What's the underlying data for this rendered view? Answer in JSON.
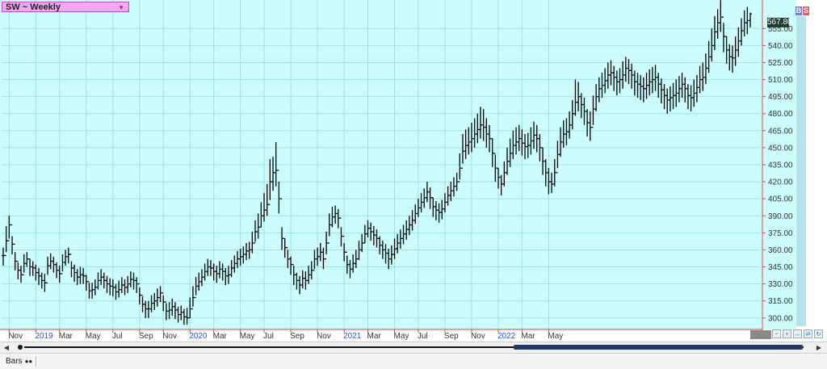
{
  "window": {
    "symbol_label": "SW ~ Weekly",
    "last_price": "567.80",
    "buy_label": "B",
    "sell_label": "S",
    "tab_label": "Bars"
  },
  "colors": {
    "plot_bg": "#ccfcfc",
    "grid": "#9ee0ea",
    "bar": "#000000",
    "axis_line": "#d44",
    "axis_text": "#333",
    "year_text": "#2a4fd0"
  },
  "chart_data": {
    "type": "ohlc",
    "title": "",
    "xlabel": "",
    "ylabel": "",
    "ylim": [
      290,
      580
    ],
    "y_ticks": [
      300,
      315,
      330,
      345,
      360,
      375,
      390,
      405,
      420,
      435,
      450,
      465,
      480,
      495,
      510,
      525,
      540,
      555
    ],
    "y_tick_labels": [
      "300.00",
      "315.00",
      "330.00",
      "345.00",
      "360.00",
      "375.00",
      "390.00",
      "405.00",
      "420.00",
      "435.00",
      "450.00",
      "465.00",
      "480.00",
      "495.00",
      "510.00",
      "525.00",
      "540.00",
      "555.00"
    ],
    "x_labels": [
      {
        "text": "Nov",
        "week": 2,
        "year": false
      },
      {
        "text": "2019",
        "week": 11,
        "year": true
      },
      {
        "text": "Mar",
        "week": 19,
        "year": false
      },
      {
        "text": "May",
        "week": 28,
        "year": false
      },
      {
        "text": "Jul",
        "week": 37,
        "year": false
      },
      {
        "text": "Sep",
        "week": 46,
        "year": false
      },
      {
        "text": "Nov",
        "week": 54,
        "year": false
      },
      {
        "text": "2020",
        "week": 63,
        "year": true
      },
      {
        "text": "Mar",
        "week": 71,
        "year": false
      },
      {
        "text": "May",
        "week": 80,
        "year": false
      },
      {
        "text": "Jul",
        "week": 88,
        "year": false
      },
      {
        "text": "Sep",
        "week": 97,
        "year": false
      },
      {
        "text": "Nov",
        "week": 106,
        "year": false
      },
      {
        "text": "2021",
        "week": 115,
        "year": true
      },
      {
        "text": "Mar",
        "week": 123,
        "year": false
      },
      {
        "text": "May",
        "week": 132,
        "year": false
      },
      {
        "text": "Jul",
        "week": 140,
        "year": false
      },
      {
        "text": "Sep",
        "week": 149,
        "year": false
      },
      {
        "text": "Nov",
        "week": 158,
        "year": false
      },
      {
        "text": "2022",
        "week": 167,
        "year": true
      },
      {
        "text": "Mar",
        "week": 175,
        "year": false
      },
      {
        "text": "May",
        "week": 184,
        "year": false
      }
    ],
    "closes": [
      355,
      368,
      382,
      365,
      350,
      342,
      338,
      348,
      352,
      345,
      344,
      340,
      337,
      333,
      331,
      346,
      350,
      347,
      342,
      339,
      349,
      354,
      356,
      344,
      340,
      336,
      338,
      337,
      332,
      324,
      325,
      327,
      333,
      336,
      333,
      330,
      328,
      327,
      323,
      325,
      329,
      327,
      330,
      334,
      333,
      330,
      320,
      312,
      308,
      308,
      313,
      315,
      318,
      322,
      314,
      306,
      307,
      310,
      307,
      303,
      305,
      301,
      300,
      308,
      318,
      328,
      332,
      336,
      341,
      345,
      344,
      341,
      339,
      343,
      341,
      337,
      338,
      344,
      348,
      352,
      354,
      356,
      359,
      360,
      366,
      376,
      380,
      390,
      395,
      400,
      420,
      428,
      430,
      405,
      370,
      362,
      352,
      347,
      338,
      333,
      329,
      335,
      333,
      338,
      342,
      352,
      354,
      358,
      352,
      366,
      382,
      389,
      392,
      388,
      372,
      358,
      347,
      343,
      348,
      352,
      360,
      366,
      374,
      379,
      376,
      373,
      370,
      364,
      360,
      357,
      352,
      356,
      361,
      366,
      370,
      374,
      378,
      382,
      386,
      392,
      397,
      402,
      406,
      411,
      406,
      398,
      395,
      393,
      396,
      402,
      408,
      412,
      416,
      420,
      432,
      447,
      452,
      455,
      458,
      462,
      466,
      470,
      468,
      462,
      458,
      445,
      432,
      424,
      418,
      428,
      438,
      445,
      452,
      455,
      458,
      454,
      451,
      452,
      456,
      461,
      458,
      450,
      438,
      428,
      420,
      418,
      428,
      444,
      455,
      462,
      464,
      470,
      480,
      490,
      495,
      488,
      482,
      472,
      468,
      484,
      495,
      502,
      505,
      509,
      514,
      516,
      512,
      508,
      510,
      514,
      520,
      518,
      514,
      508,
      506,
      504,
      502,
      505,
      508,
      510,
      512,
      506,
      501,
      496,
      492,
      494,
      496,
      498,
      502,
      506,
      502,
      496,
      494,
      498,
      503,
      510,
      512,
      520,
      530,
      540,
      552,
      560,
      565,
      548,
      536,
      530,
      529,
      536,
      544,
      553,
      560,
      562,
      567.8
    ],
    "highs": [
      362,
      381,
      390,
      372,
      358,
      349,
      346,
      356,
      358,
      352,
      350,
      347,
      344,
      340,
      339,
      354,
      357,
      354,
      349,
      346,
      356,
      360,
      362,
      350,
      347,
      343,
      345,
      344,
      338,
      331,
      331,
      334,
      340,
      343,
      340,
      337,
      335,
      334,
      330,
      333,
      336,
      334,
      337,
      341,
      340,
      336,
      327,
      319,
      315,
      315,
      320,
      322,
      326,
      328,
      320,
      313,
      314,
      317,
      314,
      310,
      311,
      308,
      309,
      318,
      328,
      336,
      340,
      343,
      348,
      352,
      351,
      348,
      346,
      350,
      348,
      344,
      346,
      351,
      355,
      359,
      361,
      363,
      366,
      367,
      376,
      386,
      392,
      402,
      410,
      418,
      440,
      442,
      455,
      420,
      380,
      370,
      360,
      354,
      346,
      340,
      337,
      342,
      341,
      346,
      350,
      360,
      362,
      366,
      362,
      376,
      392,
      398,
      399,
      396,
      380,
      366,
      355,
      351,
      356,
      360,
      368,
      374,
      382,
      386,
      384,
      381,
      378,
      372,
      368,
      365,
      361,
      364,
      370,
      374,
      378,
      382,
      386,
      390,
      395,
      400,
      405,
      410,
      414,
      420,
      415,
      406,
      403,
      401,
      404,
      410,
      416,
      420,
      424,
      428,
      445,
      462,
      466,
      468,
      472,
      476,
      480,
      486,
      484,
      476,
      470,
      458,
      444,
      432,
      426,
      438,
      450,
      458,
      465,
      468,
      470,
      466,
      462,
      463,
      468,
      473,
      470,
      462,
      450,
      440,
      432,
      428,
      440,
      456,
      468,
      474,
      476,
      482,
      492,
      510,
      508,
      498,
      494,
      484,
      482,
      496,
      506,
      512,
      516,
      520,
      525,
      527,
      522,
      518,
      520,
      526,
      530,
      528,
      524,
      518,
      516,
      514,
      512,
      516,
      519,
      521,
      523,
      516,
      511,
      506,
      502,
      504,
      507,
      510,
      513,
      516,
      512,
      506,
      505,
      510,
      514,
      522,
      525,
      533,
      544,
      555,
      566,
      572,
      580,
      560,
      548,
      541,
      540,
      548,
      556,
      564,
      571,
      574,
      569
    ],
    "lows": [
      346,
      358,
      370,
      356,
      342,
      334,
      331,
      340,
      345,
      337,
      337,
      333,
      329,
      326,
      323,
      338,
      343,
      340,
      335,
      331,
      341,
      346,
      348,
      336,
      332,
      329,
      330,
      330,
      324,
      317,
      317,
      320,
      325,
      329,
      326,
      322,
      320,
      319,
      316,
      318,
      322,
      320,
      322,
      327,
      325,
      322,
      312,
      305,
      300,
      300,
      305,
      307,
      310,
      314,
      306,
      298,
      299,
      302,
      299,
      296,
      298,
      294,
      294,
      300,
      310,
      320,
      324,
      328,
      333,
      337,
      337,
      333,
      331,
      335,
      333,
      329,
      330,
      336,
      340,
      344,
      346,
      348,
      351,
      352,
      357,
      367,
      370,
      380,
      385,
      390,
      404,
      412,
      416,
      392,
      360,
      353,
      344,
      338,
      329,
      325,
      321,
      326,
      325,
      330,
      334,
      343,
      346,
      350,
      343,
      356,
      372,
      380,
      383,
      379,
      363,
      350,
      339,
      335,
      340,
      344,
      351,
      358,
      366,
      371,
      368,
      364,
      362,
      356,
      352,
      348,
      343,
      347,
      352,
      357,
      361,
      365,
      369,
      373,
      377,
      383,
      389,
      393,
      397,
      402,
      396,
      389,
      386,
      384,
      387,
      393,
      399,
      403,
      407,
      412,
      422,
      436,
      440,
      444,
      446,
      450,
      454,
      458,
      456,
      450,
      446,
      433,
      420,
      414,
      408,
      416,
      426,
      433,
      440,
      444,
      447,
      443,
      440,
      441,
      444,
      449,
      446,
      438,
      426,
      416,
      409,
      410,
      416,
      432,
      442,
      450,
      452,
      458,
      466,
      478,
      482,
      476,
      470,
      460,
      456,
      470,
      482,
      490,
      494,
      498,
      502,
      505,
      500,
      496,
      498,
      502,
      508,
      506,
      502,
      496,
      494,
      492,
      490,
      493,
      496,
      498,
      500,
      494,
      489,
      484,
      480,
      482,
      484,
      486,
      490,
      494,
      490,
      484,
      482,
      486,
      490,
      498,
      500,
      506,
      516,
      526,
      536,
      546,
      552,
      534,
      524,
      518,
      516,
      522,
      530,
      540,
      548,
      550,
      556
    ]
  }
}
